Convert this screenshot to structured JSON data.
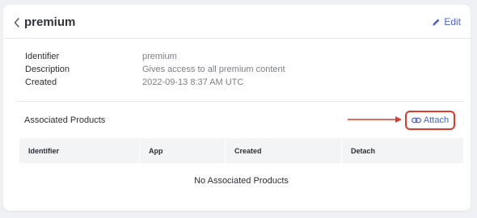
{
  "header": {
    "title": "premium",
    "edit_label": "Edit"
  },
  "details": [
    {
      "label": "Identifier",
      "value": "premium"
    },
    {
      "label": "Description",
      "value": "Gives access to all premium content"
    },
    {
      "label": "Created",
      "value": "2022-09-13 8:37 AM UTC"
    }
  ],
  "associated_products": {
    "title": "Associated Products",
    "attach_label": "Attach",
    "columns": [
      "Identifier",
      "App",
      "Created",
      "Detach"
    ],
    "empty_text": "No Associated Products"
  },
  "colors": {
    "accent": "#4a62d6",
    "highlight": "#e03a2e"
  },
  "icons": {
    "back": "chevron-left-icon",
    "edit": "pencil-icon",
    "attach": "link-icon",
    "annotation": "arrow-right-icon"
  }
}
